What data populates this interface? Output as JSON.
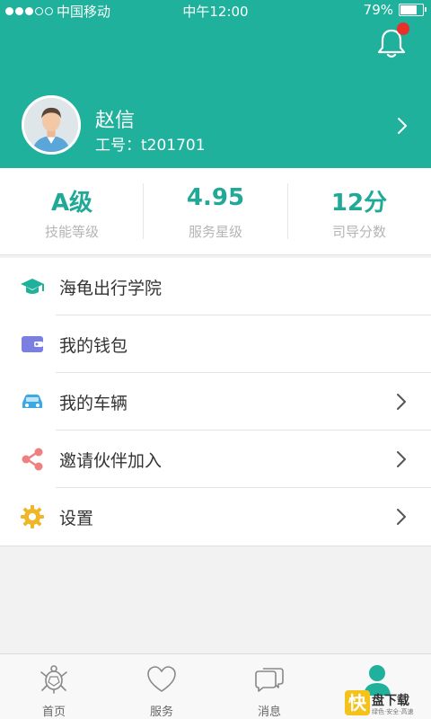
{
  "status_bar": {
    "carrier": "中国移动",
    "time": "中午12:00",
    "battery": "79%",
    "battery_level": 0.79
  },
  "profile": {
    "name": "赵信",
    "employee_id": "工号：t201701"
  },
  "stats": [
    {
      "value": "A级",
      "label": "技能等级"
    },
    {
      "value": "4.95",
      "label": "服务星级"
    },
    {
      "value": "12分",
      "label": "司导分数"
    }
  ],
  "menu": [
    {
      "label": "海龟出行学院",
      "icon": "graduation-cap-icon",
      "color": "#1fb19b",
      "has_chevron": false
    },
    {
      "label": "我的钱包",
      "icon": "wallet-icon",
      "color": "#7b7fe0",
      "has_chevron": false
    },
    {
      "label": "我的车辆",
      "icon": "car-icon",
      "color": "#3aa9e6",
      "has_chevron": true
    },
    {
      "label": "邀请伙伴加入",
      "icon": "share-icon",
      "color": "#ef8080",
      "has_chevron": true
    },
    {
      "label": "设置",
      "icon": "gear-icon",
      "color": "#f0b62a",
      "has_chevron": true
    }
  ],
  "tabs": [
    {
      "label": "首页",
      "icon": "turtle-icon"
    },
    {
      "label": "服务",
      "icon": "heart-icon"
    },
    {
      "label": "消息",
      "icon": "chat-icon"
    },
    {
      "label": "",
      "icon": "person-icon",
      "active": true
    }
  ],
  "watermark": {
    "letter": "快",
    "text": "盘下载",
    "sub": "绿色·安全·高速"
  },
  "colors": {
    "accent": "#1fb19b",
    "notification": "#e8312d"
  }
}
